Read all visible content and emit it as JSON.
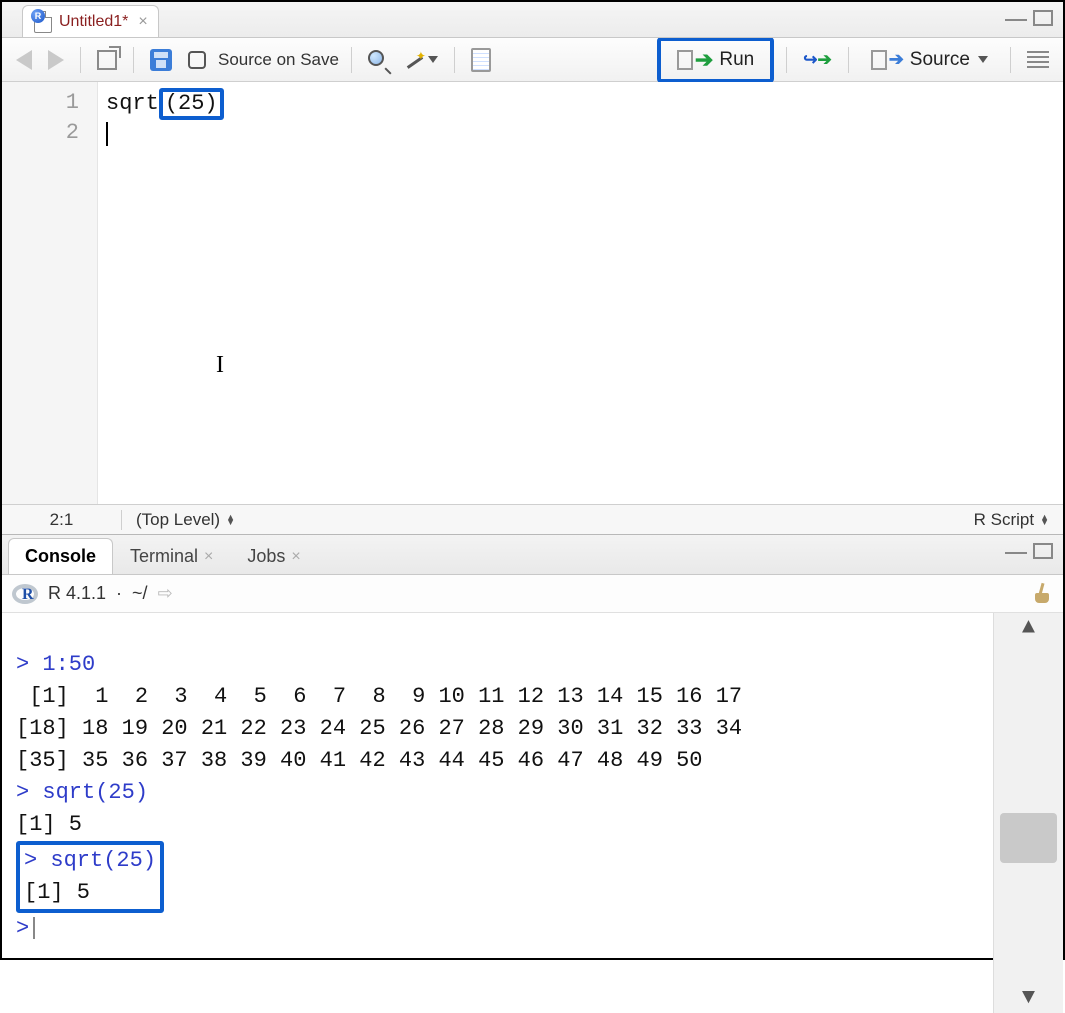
{
  "source": {
    "tab_title": "Untitled1*",
    "toolbar": {
      "source_on_save_label": "Source on Save",
      "run_label": "Run",
      "source_label": "Source"
    },
    "code": {
      "line_numbers": [
        "1",
        "2"
      ],
      "line1_prefix": "sqrt",
      "line1_highlight": "(25)"
    },
    "status": {
      "cursor_pos": "2:1",
      "scope": "(Top Level)",
      "file_type": "R Script"
    }
  },
  "console": {
    "tabs": {
      "console": "Console",
      "terminal": "Terminal",
      "jobs": "Jobs"
    },
    "header": {
      "version": "R 4.1.1",
      "sep": "·",
      "wd": "~/"
    },
    "output": {
      "l1_prompt": ">",
      "l1_cmd": " 1:50",
      "l2": " [1]  1  2  3  4  5  6  7  8  9 10 11 12 13 14 15 16 17",
      "l3": "[18] 18 19 20 21 22 23 24 25 26 27 28 29 30 31 32 33 34",
      "l4": "[35] 35 36 37 38 39 40 41 42 43 44 45 46 47 48 49 50",
      "l5_prompt": ">",
      "l5_cmd": " sqrt(25)",
      "l6": "[1] 5",
      "l7_prompt": ">",
      "l7_cmd": " sqrt(25)",
      "l8": "[1] 5",
      "l9_prompt": ">"
    }
  }
}
